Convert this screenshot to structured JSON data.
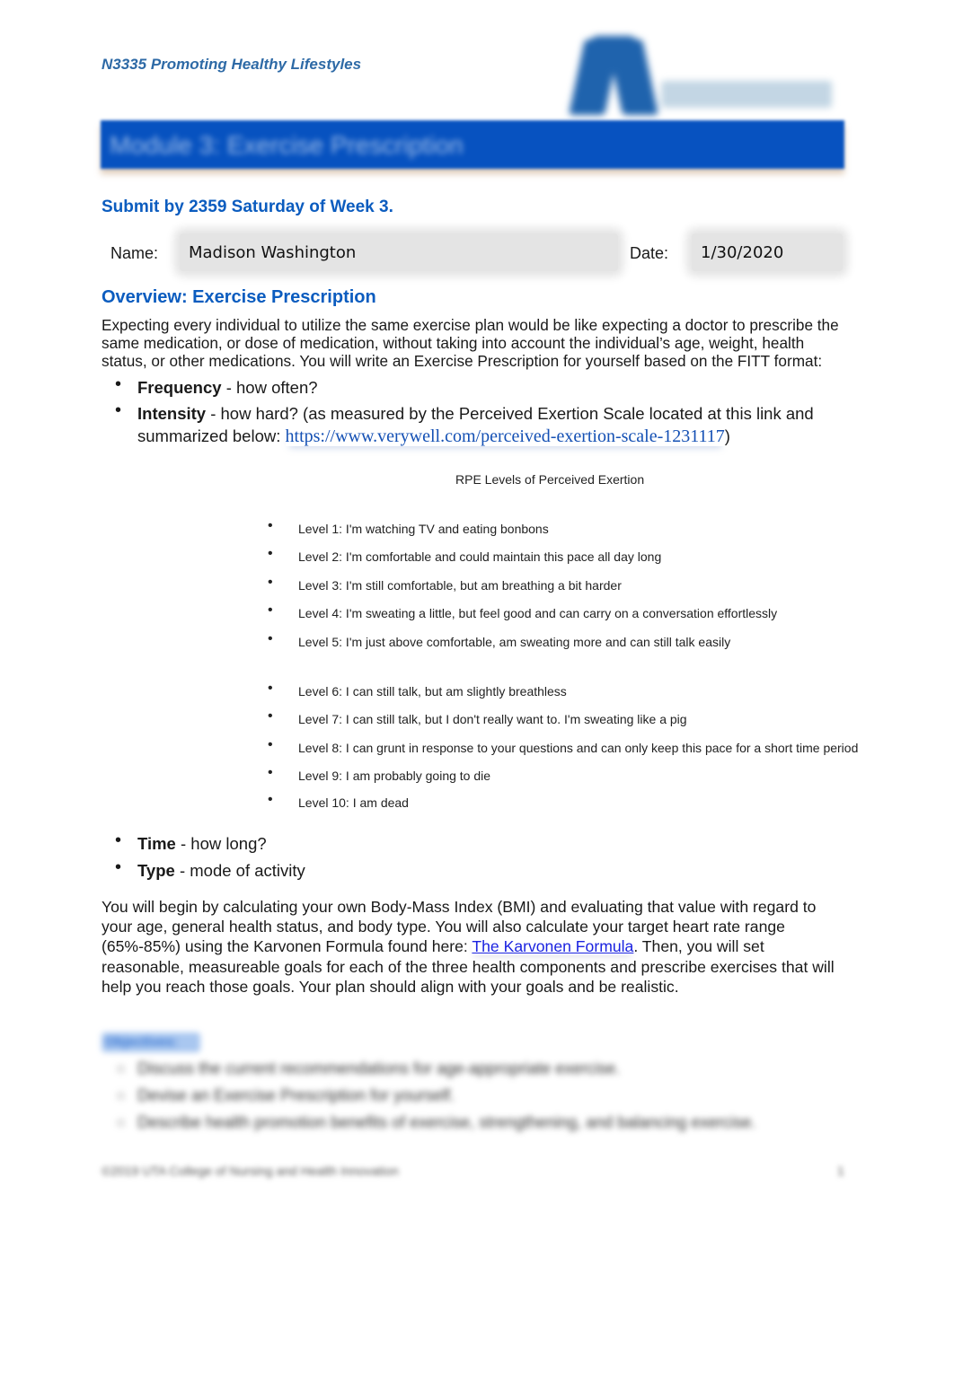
{
  "header": {
    "course_title": "N3335 Promoting Healthy Lifestyles",
    "logo_icon": "university-logo-icon",
    "module_title": "Module 3: Exercise Prescription"
  },
  "submit_note": "Submit by 2359 Saturday of Week 3.",
  "form": {
    "name_label": "Name:",
    "name_value": "Madison Washington",
    "date_label": "Date:",
    "date_value": "1/30/2020"
  },
  "overview": {
    "heading": "Overview: Exercise Prescription",
    "intro": "Expecting every individual to utilize the same exercise plan would be like expecting a doctor to prescribe the same medication, or dose of medication, without taking into account the individual’s age, weight, health status, or other medications. You will write an Exercise Prescription for yourself based on the FITT format:",
    "fitt": [
      {
        "term": "Frequency",
        "desc": " - how often?"
      },
      {
        "term": "Intensity",
        "desc": " - how hard? (as measured by the Perceived Exertion Scale located at this link and",
        "desc2": "summarized below: ",
        "link": "https://www.verywell.com/perceived-exertion-scale-1231117",
        "after_link": ")"
      },
      {
        "term": "Time",
        "desc": " - how long?"
      },
      {
        "term": "Type",
        "desc": " - mode of activity"
      }
    ],
    "rpe": {
      "title": "RPE Levels of Perceived Exertion",
      "levels": [
        "Level 1: I'm watching TV and eating bonbons",
        "Level 2: I'm comfortable and could maintain this pace all day long",
        "Level 3: I'm still comfortable, but am breathing a bit harder",
        "Level 4: I'm sweating a little, but feel good and can carry on a conversation effortlessly",
        "Level 5: I'm just above comfortable, am sweating more and can still talk easily",
        "Level 6: I can still talk, but am slightly breathless",
        "Level 7: I can still talk, but I don't really want to. I'm sweating like a pig",
        "Level 8: I can grunt in response to your questions and can only keep this pace for a short time period",
        "Level 9: I am probably going to die",
        "Level 10: I am dead"
      ]
    },
    "closing_before_link": "You will begin by calculating your own Body-Mass Index (BMI) and evaluating that value with regard to your age, general health status, and body type. You will also calculate your target heart rate range (65%-85%) using the Karvonen Formula found here: ",
    "closing_link": "The Karvonen Formula",
    "closing_after_link": ". Then, you will set reasonable, measureable goals for each of the three health components and prescribe exercises that will help you reach those goals. Your plan should align with your goals and be realistic."
  },
  "objectives": {
    "title": "Objectives:",
    "items": [
      "Discuss the current recommendations for age-appropriate exercise.",
      "Devise an Exercise Prescription for yourself.",
      "Describe health promotion benefits of exercise, strengthening, and balancing exercise."
    ]
  },
  "footer": {
    "text": "©2019 UTA College of Nursing and Health Innovation",
    "page": "1"
  }
}
